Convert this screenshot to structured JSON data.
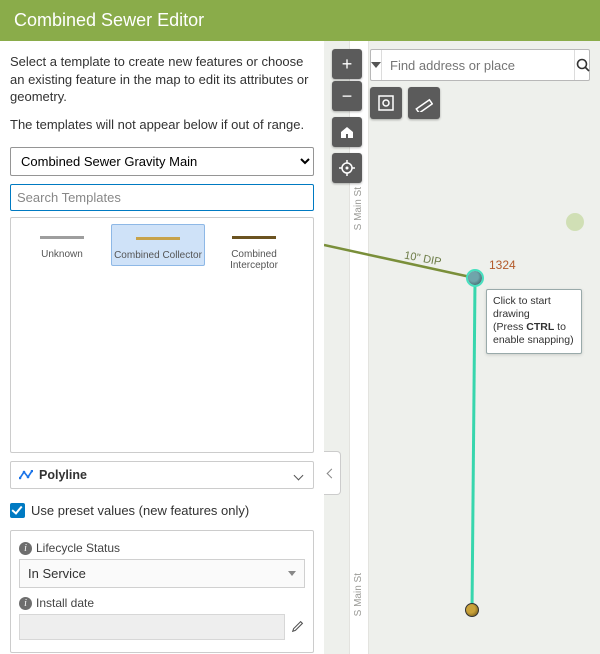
{
  "header": {
    "title": "Combined Sewer Editor"
  },
  "panel": {
    "intro": "Select a template to create new features or choose an existing feature in the map to edit its attributes or geometry.",
    "range_note": "The templates will not appear below if out of range.",
    "layer_select": "Combined Sewer Gravity Main",
    "search_placeholder": "Search Templates",
    "templates": [
      {
        "label": "Unknown",
        "color": "#9e9e9e",
        "selected": false
      },
      {
        "label": "Combined Collector",
        "color": "#c7a24a",
        "selected": true
      },
      {
        "label": "Combined Interceptor",
        "color": "#6b5320",
        "selected": false
      }
    ],
    "geometry": {
      "label": "Polyline"
    },
    "preset_checkbox": {
      "checked": true,
      "label": "Use preset values (new features only)"
    },
    "fields": {
      "lifecycle": {
        "label": "Lifecycle Status",
        "value": "In Service"
      },
      "install_date": {
        "label": "Install date",
        "value": ""
      }
    }
  },
  "map": {
    "search_placeholder": "Find address or place",
    "road_label": "S Main St",
    "pipe_label": "10\" DIP",
    "node_label": "1324",
    "tooltip": {
      "line1": "Click to start drawing",
      "line2p1": "(Press ",
      "ctrl": "CTRL",
      "line2p2": " to enable snapping)"
    }
  }
}
